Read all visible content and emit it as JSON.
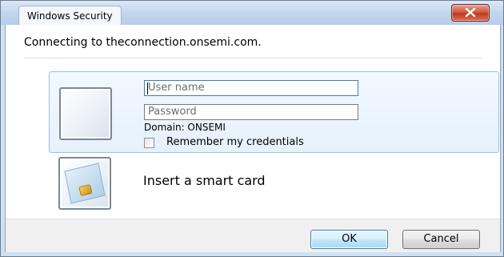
{
  "window": {
    "title": "Windows Security"
  },
  "header": {
    "message": "Connecting to theconnection.onsemi.com."
  },
  "credentials": {
    "username_placeholder": "User name",
    "username_value": "",
    "password_placeholder": "Password",
    "password_value": "",
    "domain_text": "Domain: ONSEMI",
    "remember_label": "Remember my credentials",
    "remember_checked": false,
    "user_tile_icon": "user-tile-icon"
  },
  "smartcard": {
    "label": "Insert a smart card",
    "icon": "smart-card-icon"
  },
  "footer": {
    "ok_label": "OK",
    "cancel_label": "Cancel"
  },
  "colors": {
    "titlebar": "#c3d6ee",
    "close_button": "#c0391b",
    "selected_panel": "#e6f1fc",
    "selected_panel_border": "#98c1ea",
    "default_button_border": "#3c7fb1"
  }
}
